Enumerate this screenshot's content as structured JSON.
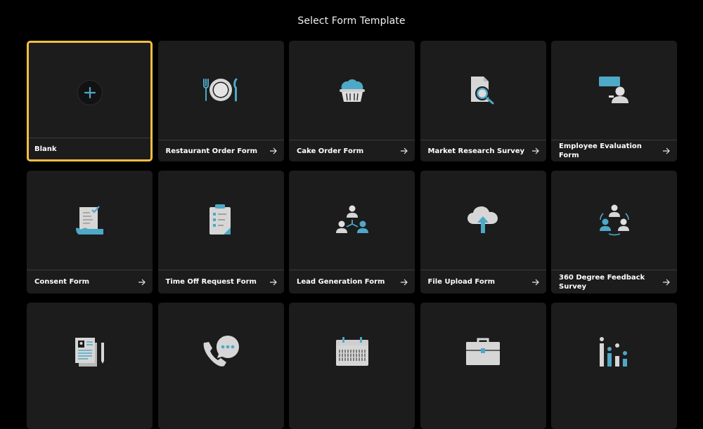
{
  "header": {
    "title": "Select Form Template"
  },
  "colors": {
    "accent": "#4ea8c7",
    "selected_border": "#f5bf42",
    "card_bg": "#1c1c1c"
  },
  "templates": [
    {
      "label": "Blank",
      "icon": "plus-icon",
      "selected": true
    },
    {
      "label": "Restaurant Order Form",
      "icon": "plate-cutlery-icon"
    },
    {
      "label": "Cake Order Form",
      "icon": "cupcake-icon"
    },
    {
      "label": "Market Research Survey",
      "icon": "document-magnifier-icon"
    },
    {
      "label": "Employee Evaluation Form",
      "icon": "presenter-icon"
    },
    {
      "label": "Consent Form",
      "icon": "signed-document-icon"
    },
    {
      "label": "Time Off Request Form",
      "icon": "clipboard-checklist-icon"
    },
    {
      "label": "Lead Generation Form",
      "icon": "people-network-icon"
    },
    {
      "label": "File Upload Form",
      "icon": "cloud-upload-icon"
    },
    {
      "label": "360 Degree Feedback Survey",
      "icon": "people-cycle-icon"
    },
    {
      "label": "",
      "icon": "resume-document-icon"
    },
    {
      "label": "",
      "icon": "phone-chat-icon"
    },
    {
      "label": "",
      "icon": "calendar-icon"
    },
    {
      "label": "",
      "icon": "briefcase-icon"
    },
    {
      "label": "",
      "icon": "bar-chart-icon"
    }
  ]
}
